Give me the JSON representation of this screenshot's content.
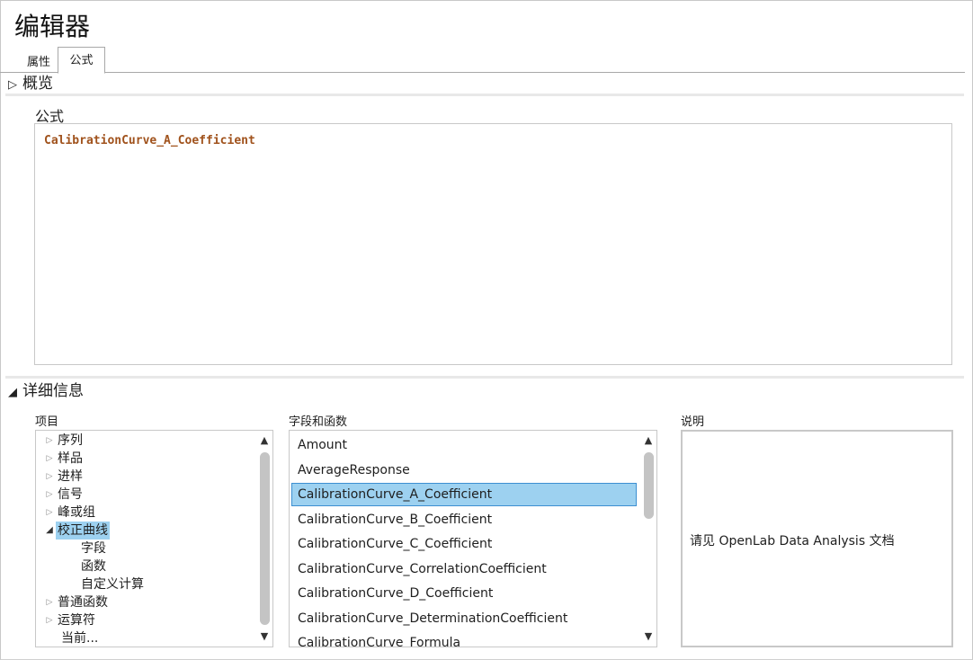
{
  "window": {
    "title": "编辑器"
  },
  "tabs": {
    "properties": "属性",
    "formula": "公式"
  },
  "overview": {
    "label": "概览",
    "toggle": "▷"
  },
  "formula": {
    "label": "公式",
    "expression": "CalibrationCurve_A_Coefficient"
  },
  "details": {
    "label": "详细信息",
    "toggle": "◢",
    "items_label": "项目",
    "fields_label": "字段和函数",
    "desc_label": "说明",
    "tree": [
      {
        "label": "序列",
        "expander": "▷"
      },
      {
        "label": "样品",
        "expander": "▷"
      },
      {
        "label": "进样",
        "expander": "▷"
      },
      {
        "label": "信号",
        "expander": "▷"
      },
      {
        "label": "峰或组",
        "expander": "▷"
      },
      {
        "label": "校正曲线",
        "expander": "◢",
        "selected": true
      },
      {
        "label": "字段",
        "expander": ""
      },
      {
        "label": "函数",
        "expander": ""
      },
      {
        "label": "自定义计算",
        "expander": ""
      },
      {
        "label": "普通函数",
        "expander": "▷"
      },
      {
        "label": "运算符",
        "expander": "▷"
      },
      {
        "label": "当前...",
        "expander": ""
      }
    ],
    "fields": [
      "Amount",
      "AverageResponse",
      "CalibrationCurve_A_Coefficient",
      "CalibrationCurve_B_Coefficient",
      "CalibrationCurve_C_Coefficient",
      "CalibrationCurve_CorrelationCoefficient",
      "CalibrationCurve_D_Coefficient",
      "CalibrationCurve_DeterminationCoefficient",
      "CalibrationCurve_Formula"
    ],
    "selected_field": "CalibrationCurve_A_Coefficient",
    "description": "请见 OpenLab Data Analysis 文档"
  },
  "scroll": {
    "up": "▲",
    "down": "▼"
  },
  "colors": {
    "selection": "#9dd1f0",
    "formula_text": "#a0521c"
  }
}
